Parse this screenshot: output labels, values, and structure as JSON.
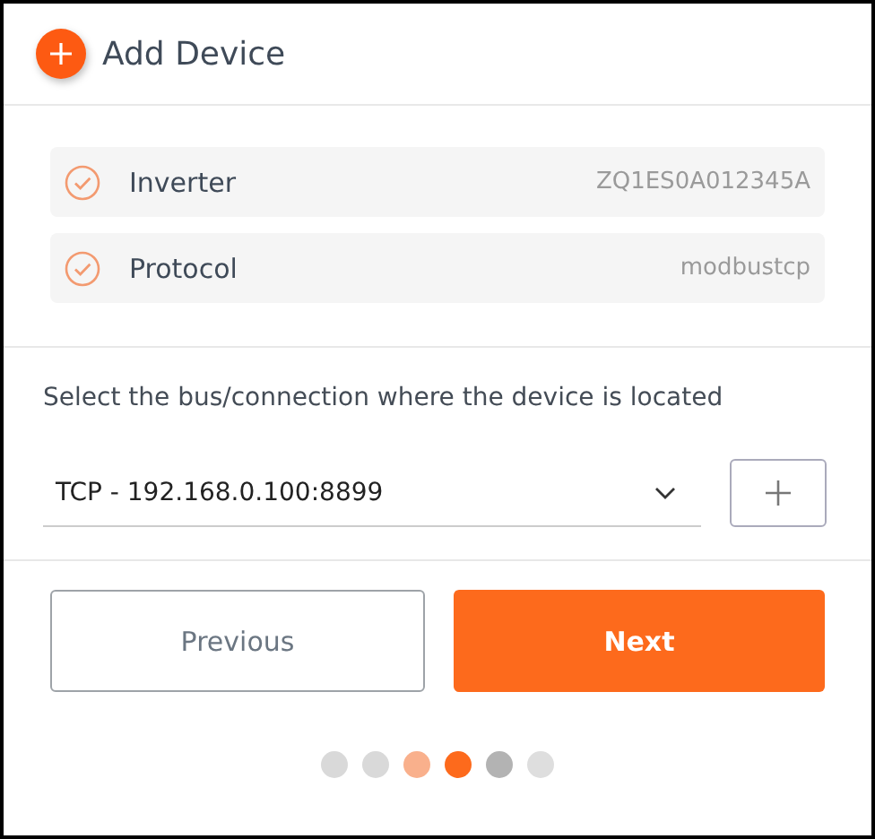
{
  "header": {
    "title": "Add Device"
  },
  "summary": [
    {
      "label": "Inverter",
      "value": "ZQ1ES0A012345A",
      "checked": true
    },
    {
      "label": "Protocol",
      "value": "modbustcp",
      "checked": true
    }
  ],
  "prompt": "Select the bus/connection where the device is located",
  "connection": {
    "value": "TCP - 192.168.0.100:8899"
  },
  "buttons": [
    {
      "label": "Previous",
      "kind": "secondary"
    },
    {
      "label": "Next",
      "kind": "primary"
    }
  ],
  "steps": [
    {
      "color": "#d9d9d9"
    },
    {
      "color": "#d9d9d9"
    },
    {
      "color": "#f9b08c"
    },
    {
      "color": "#fd6a1c"
    },
    {
      "color": "#b3b3b3"
    },
    {
      "color": "#dedede"
    }
  ]
}
